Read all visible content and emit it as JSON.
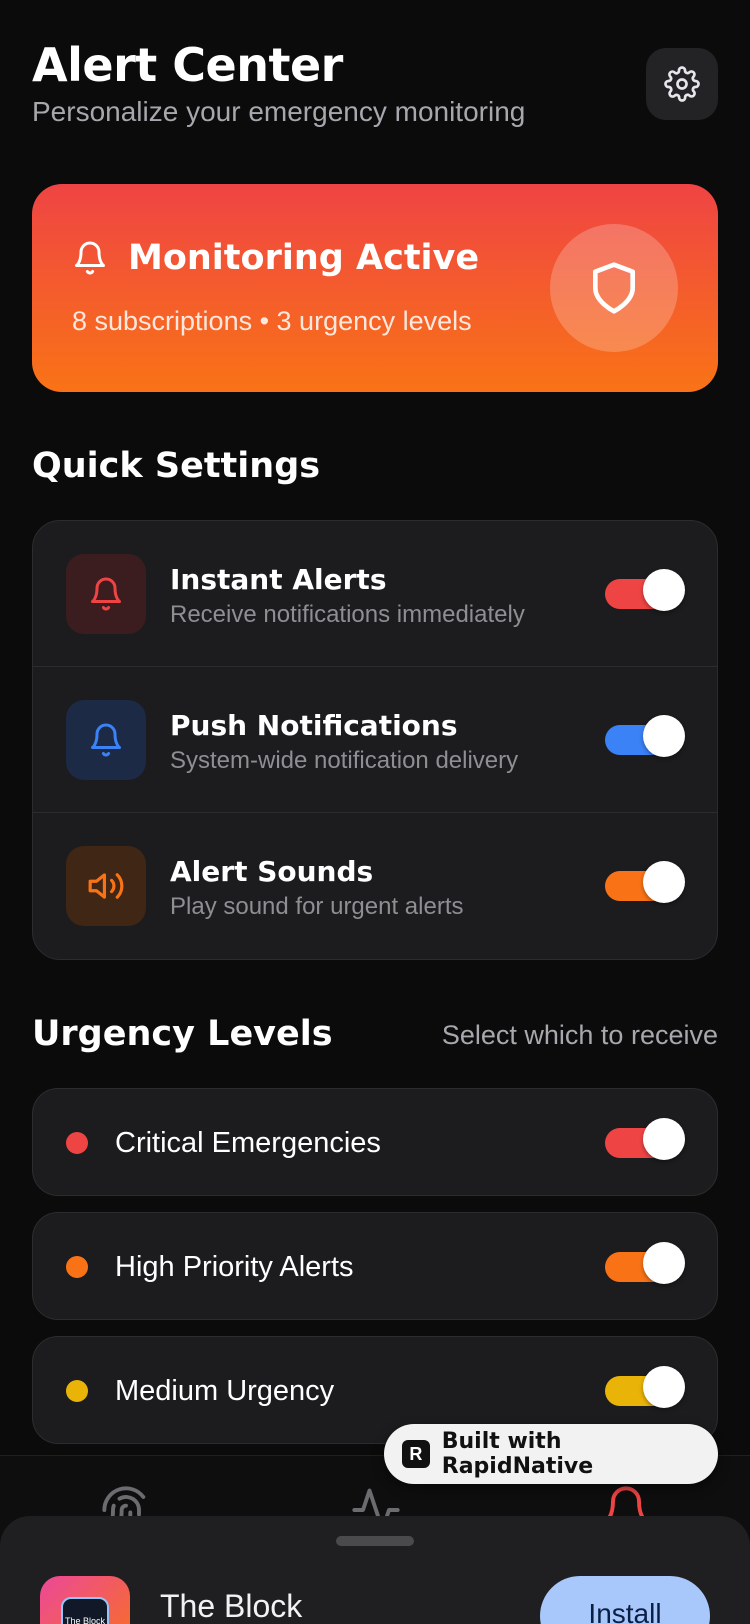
{
  "header": {
    "title": "Alert Center",
    "subtitle": "Personalize your emergency monitoring"
  },
  "monitor": {
    "title": "Monitoring Active",
    "summary": "8 subscriptions • 3 urgency levels"
  },
  "quick_settings": {
    "title": "Quick Settings",
    "items": [
      {
        "label": "Instant Alerts",
        "desc": "Receive notifications immediately",
        "icon": "bell-icon",
        "color": "#ef4444",
        "bg": "#3b1d1f",
        "on": true
      },
      {
        "label": "Push Notifications",
        "desc": "System-wide notification delivery",
        "icon": "bell-icon",
        "color": "#3b82f6",
        "bg": "#1c2a45",
        "on": true
      },
      {
        "label": "Alert Sounds",
        "desc": "Play sound for urgent alerts",
        "icon": "speaker-icon",
        "color": "#f97316",
        "bg": "#3f2615",
        "on": true
      }
    ]
  },
  "urgency": {
    "title": "Urgency Levels",
    "hint": "Select which to receive",
    "items": [
      {
        "label": "Critical Emergencies",
        "color": "#ef4444",
        "on": true
      },
      {
        "label": "High Priority Alerts",
        "color": "#f97316",
        "on": true
      },
      {
        "label": "Medium Urgency",
        "color": "#eab308",
        "on": true
      }
    ]
  },
  "badge": {
    "text": "Built with RapidNative"
  },
  "sheet": {
    "app_name": "The Block",
    "app_icon_text": "The Block",
    "install_label": "Install"
  },
  "colors": {
    "accent_red": "#ef4444",
    "accent_orange": "#f97316",
    "accent_blue": "#3b82f6",
    "accent_yellow": "#eab308"
  }
}
